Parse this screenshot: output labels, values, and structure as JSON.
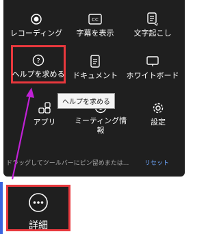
{
  "toolbar": {
    "items": [
      {
        "label": "レコーディング",
        "icon": "record-icon"
      },
      {
        "label": "字幕を表示",
        "icon": "captions-icon"
      },
      {
        "label": "文字起こし",
        "icon": "transcript-icon"
      },
      {
        "label": "ヘルプを求める",
        "icon": "help-icon"
      },
      {
        "label": "ドキュメント",
        "icon": "document-icon"
      },
      {
        "label": "ホワイトボード",
        "icon": "whiteboard-icon"
      },
      {
        "label": "アプリ",
        "icon": "apps-icon"
      },
      {
        "label": "ミーティング情\n報",
        "icon": "info-icon"
      },
      {
        "label": "設定",
        "icon": "gear-icon"
      }
    ],
    "tooltip": "ヘルプを求める",
    "footer_hint": "ドラッグしてツールバーにピン留めまたは...",
    "reset_label": "リセット"
  },
  "more_button": {
    "label": "詳細",
    "icon": "more-icon"
  },
  "colors": {
    "highlight": "#e8383d",
    "arrow": "#c021d6",
    "link": "#6fa8ff",
    "panel": "#1f1f1f"
  }
}
